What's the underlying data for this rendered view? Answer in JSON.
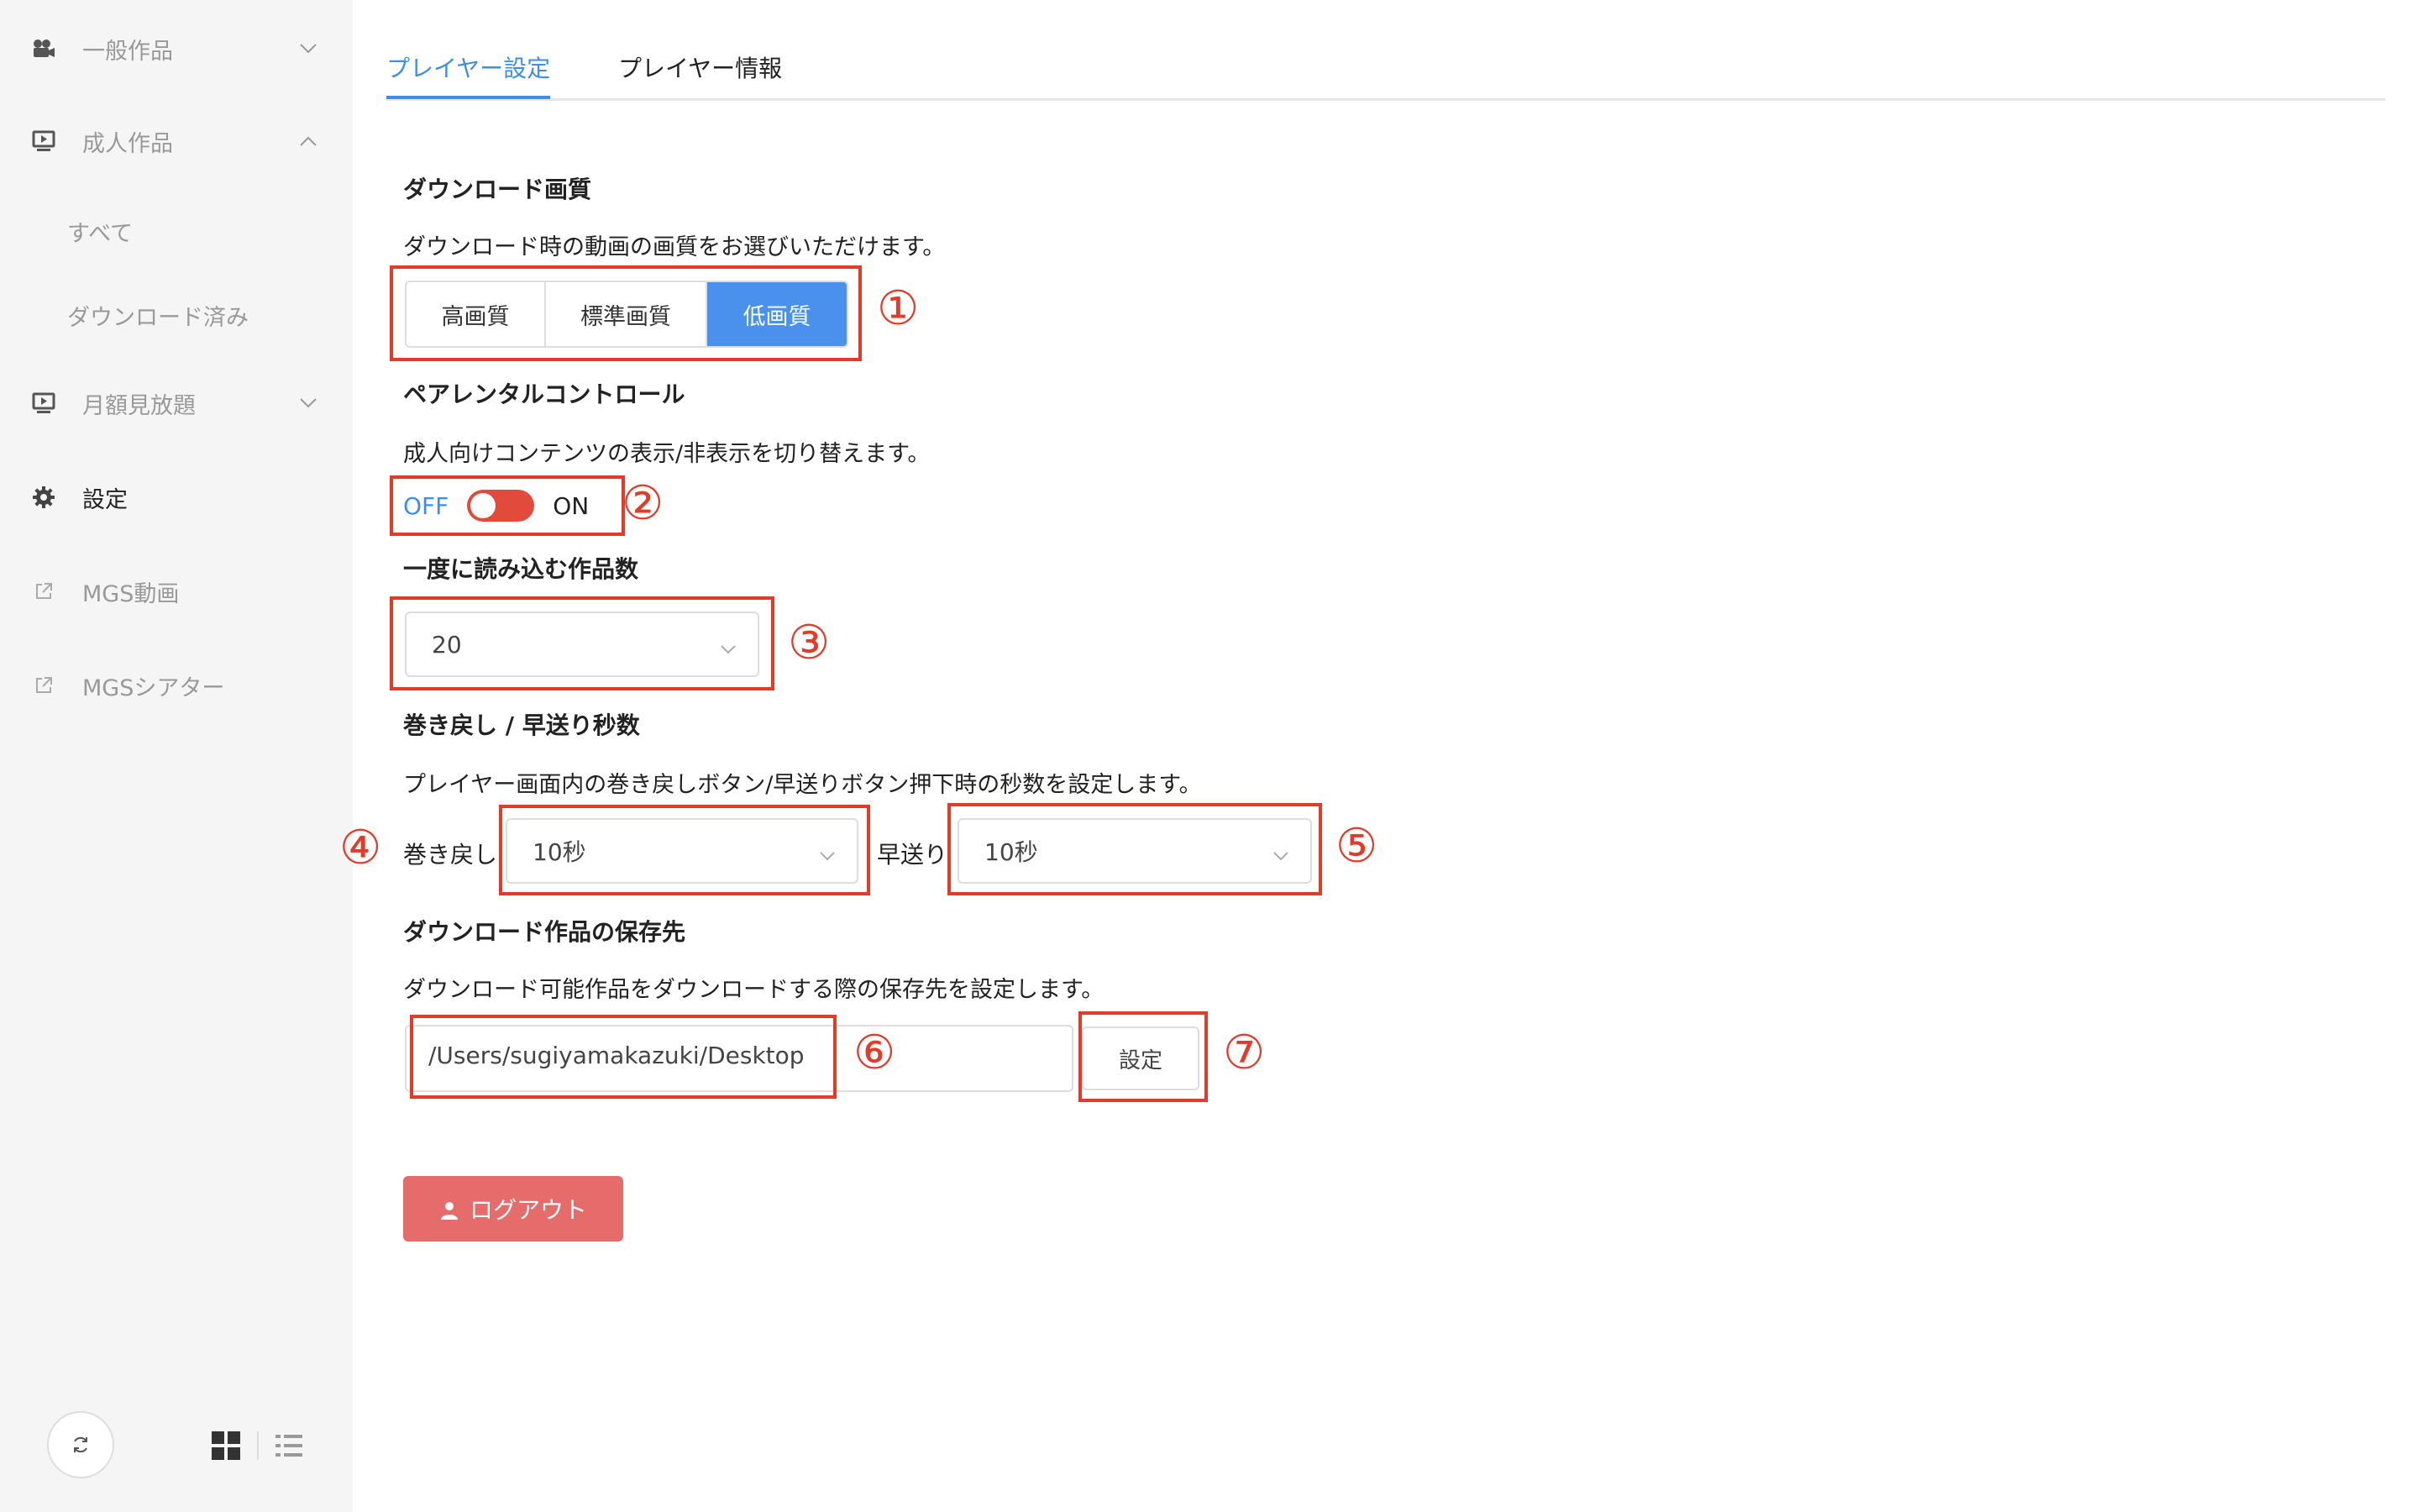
{
  "sidebar": {
    "items": [
      {
        "label": "一般作品",
        "icon": "film-camera-icon",
        "chevron": "down"
      },
      {
        "label": "成人作品",
        "icon": "monitor-play-icon",
        "chevron": "up"
      },
      {
        "label": "月額見放題",
        "icon": "monitor-play-icon",
        "chevron": "down"
      },
      {
        "label": "設定",
        "icon": "gear-icon"
      },
      {
        "label": "MGS動画",
        "icon": "external-link-icon"
      },
      {
        "label": "MGSシアター",
        "icon": "external-link-icon"
      }
    ],
    "sub_items": [
      "すべて",
      "ダウンロード済み"
    ],
    "active_item": "設定"
  },
  "tabs": [
    {
      "label": "プレイヤー設定",
      "active": true
    },
    {
      "label": "プレイヤー情報",
      "active": false
    }
  ],
  "download_quality": {
    "title": "ダウンロード画質",
    "description": "ダウンロード時の動画の画質をお選びいただけます。",
    "options": [
      "高画質",
      "標準画質",
      "低画質"
    ],
    "selected": "低画質"
  },
  "parental": {
    "title": "ペアレンタルコントロール",
    "description": "成人向けコンテンツの表示/非表示を切り替えます。",
    "off_label": "OFF",
    "on_label": "ON",
    "state": "ON"
  },
  "load_count": {
    "title": "一度に読み込む作品数",
    "value": "20"
  },
  "seek": {
    "title": "巻き戻し / 早送り秒数",
    "description": "プレイヤー画面内の巻き戻しボタン/早送りボタン押下時の秒数を設定します。",
    "rewind_label": "巻き戻し",
    "rewind_value": "10秒",
    "forward_label": "早送り",
    "forward_value": "10秒"
  },
  "save_path": {
    "title": "ダウンロード作品の保存先",
    "description": "ダウンロード可能作品をダウンロードする際の保存先を設定します。",
    "value": "/Users/sugiyamakazuki/Desktop",
    "button": "設定"
  },
  "logout": {
    "label": "ログアウト"
  },
  "annotations": [
    "①",
    "②",
    "③",
    "④",
    "⑤",
    "⑥",
    "⑦"
  ],
  "colors": {
    "accent": "#3f8de6",
    "annotation_red": "#e23b2a",
    "switch_on": "#e24a3b",
    "logout_bg": "#e66b6b"
  }
}
